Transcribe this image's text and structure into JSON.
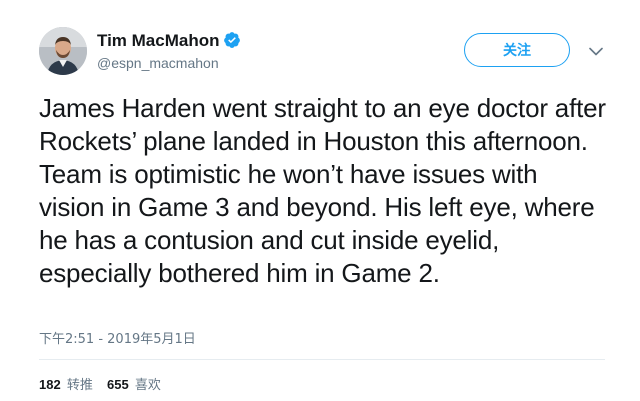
{
  "author": {
    "display_name": "Tim MacMahon",
    "handle": "@espn_macmahon",
    "verified": true
  },
  "follow_button_label": "关注",
  "tweet": {
    "text": "James Harden went straight to an eye doctor after Rockets’ plane landed in Houston this afternoon. Team is optimistic he won’t have issues with vision in Game 3 and beyond. His left eye, where he has a contusion and cut inside eyelid, especially bothered him in Game 2.",
    "timestamp": "下午2:51 - 2019年5月1日"
  },
  "stats": {
    "retweets_count": "182",
    "retweets_label": "转推",
    "likes_count": "655",
    "likes_label": "喜欢"
  },
  "colors": {
    "accent": "#1da1f2",
    "secondary_text": "#657786",
    "primary_text": "#14171a",
    "divider": "#e6ecf0"
  },
  "icons": {
    "verified": "verified-badge-icon",
    "more": "chevron-down-icon"
  }
}
